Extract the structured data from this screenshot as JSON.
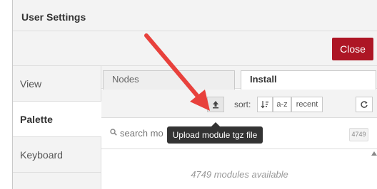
{
  "window": {
    "title": "User Settings"
  },
  "buttons": {
    "close": "Close"
  },
  "sidebar": {
    "items": [
      {
        "label": "View"
      },
      {
        "label": "Palette"
      },
      {
        "label": "Keyboard"
      }
    ],
    "active": "Palette"
  },
  "tabs": [
    {
      "label": "Nodes"
    },
    {
      "label": "Install"
    }
  ],
  "active_tab": "Install",
  "toolbar": {
    "upload_icon": "upload-icon",
    "sort_label": "sort:",
    "sort_icon": "sort-descending-icon",
    "sort_az": "a-z",
    "sort_recent": "recent",
    "refresh_icon": "refresh-icon"
  },
  "search": {
    "placeholder": "search mo",
    "count": "4749"
  },
  "tooltip": "Upload module tgz file",
  "modules_available": "4749 modules available",
  "colors": {
    "close_button": "#ad1625",
    "tooltip_bg": "#333333",
    "annotation_arrow": "#e8413c"
  }
}
